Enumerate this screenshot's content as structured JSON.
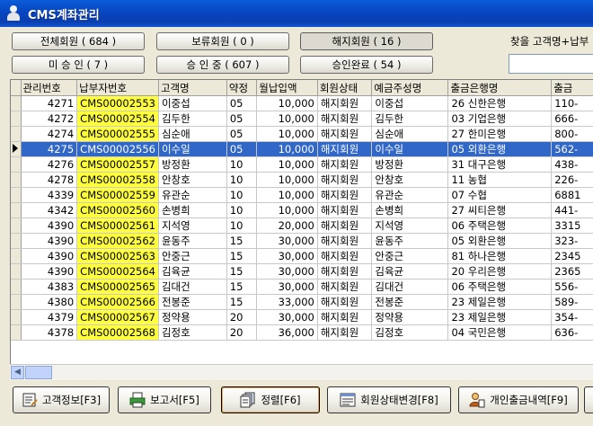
{
  "window": {
    "title": "CMS계좌관리"
  },
  "filters": {
    "total": "전체회원 ( 684 )",
    "hold": "보류회원 ( 0 )",
    "cancelled": "해지회원 ( 16 )",
    "unapproved": "미 승 인 ( 7 )",
    "approving": "승 인 중 ( 607 )",
    "approved": "승인완료 ( 54 )"
  },
  "search": {
    "label": "찾을 고객명+납부",
    "value": ""
  },
  "grid": {
    "columns": [
      "관리번호",
      "납부자번호",
      "고객명",
      "약정",
      "월납입액",
      "회원상태",
      "예금주성명",
      "출금은행명",
      "출금"
    ],
    "selected_index": 3,
    "rows": [
      [
        "4271",
        "CMS00002553",
        "이중섭",
        "05",
        "10,000",
        "해지회원",
        "이중섭",
        "26 신한은행",
        "110-"
      ],
      [
        "4272",
        "CMS00002554",
        "김두한",
        "05",
        "10,000",
        "해지회원",
        "김두한",
        "03 기업은행",
        "666-"
      ],
      [
        "4274",
        "CMS00002555",
        "심순애",
        "05",
        "10,000",
        "해지회원",
        "심순애",
        "27 한미은행",
        "800-"
      ],
      [
        "4275",
        "CMS00002556",
        "이수일",
        "05",
        "10,000",
        "해지회원",
        "이수일",
        "05 외환은행",
        "562-"
      ],
      [
        "4276",
        "CMS00002557",
        "방정환",
        "10",
        "10,000",
        "해지회원",
        "방정환",
        "31 대구은행",
        "438-"
      ],
      [
        "4278",
        "CMS00002558",
        "안창호",
        "10",
        "10,000",
        "해지회원",
        "안창호",
        "11 농협",
        "226-"
      ],
      [
        "4339",
        "CMS00002559",
        "유관순",
        "10",
        "10,000",
        "해지회원",
        "유관순",
        "07 수협",
        "6881"
      ],
      [
        "4342",
        "CMS00002560",
        "손병희",
        "10",
        "10,000",
        "해지회원",
        "손병희",
        "27 씨티은행",
        "441-"
      ],
      [
        "4390",
        "CMS00002561",
        "지석영",
        "10",
        "20,000",
        "해지회원",
        "지석영",
        "06 주택은행",
        "3315"
      ],
      [
        "4390",
        "CMS00002562",
        "윤동주",
        "15",
        "30,000",
        "해지회원",
        "윤동주",
        "05 외환은행",
        "323-"
      ],
      [
        "4390",
        "CMS00002563",
        "안중근",
        "15",
        "30,000",
        "해지회원",
        "안중근",
        "81 하나은행",
        "2345"
      ],
      [
        "4390",
        "CMS00002564",
        "김육균",
        "15",
        "30,000",
        "해지회원",
        "김육균",
        "20 우리은행",
        "2365"
      ],
      [
        "4383",
        "CMS00002565",
        "김대건",
        "15",
        "30,000",
        "해지회원",
        "김대건",
        "06 주택은행",
        "556-"
      ],
      [
        "4380",
        "CMS00002566",
        "전봉준",
        "15",
        "33,000",
        "해지회원",
        "전봉준",
        "23 제일은행",
        "589-"
      ],
      [
        "4379",
        "CMS00002567",
        "정약용",
        "20",
        "30,000",
        "해지회원",
        "정약용",
        "23 제일은행",
        "354-"
      ],
      [
        "4378",
        "CMS00002568",
        "김정호",
        "20",
        "36,000",
        "해지회원",
        "김정호",
        "04 국민은행",
        "636-"
      ]
    ]
  },
  "actions": {
    "customer_info": "고객정보[F3]",
    "report": "보고서[F5]",
    "sort": "정렬[F6]",
    "member_status": "회원상태변경[F8]",
    "withdrawal_history": "개인출금내역[F9]"
  },
  "colors": {
    "selection": "#3167c6",
    "code_highlight": "#ffff40",
    "titlebar": "#0a4fd0"
  }
}
